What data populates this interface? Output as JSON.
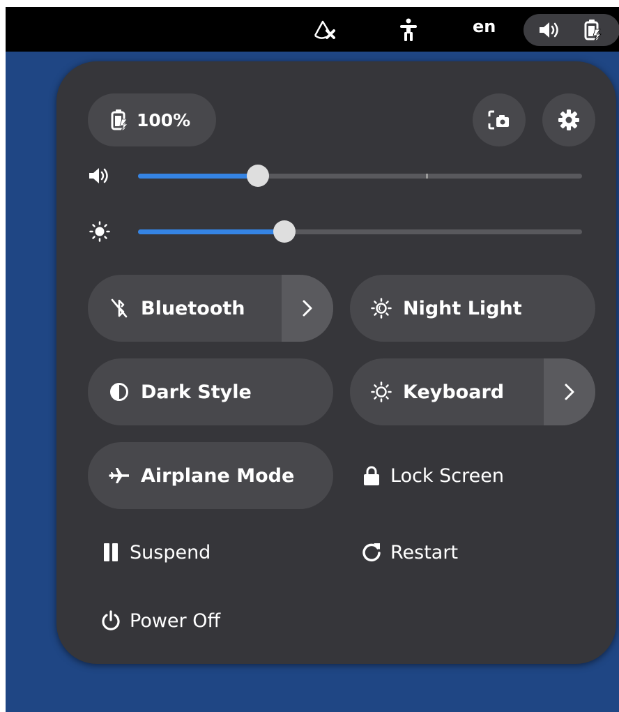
{
  "topbar": {
    "icons": [
      "no-network-icon",
      "accessibility-icon",
      "volume-icon",
      "battery-charging-icon"
    ],
    "language": "en"
  },
  "quick_settings": {
    "battery": {
      "icon": "battery-charging-icon",
      "label": "100%"
    },
    "buttons": [
      "screenshot-icon",
      "settings-icon"
    ],
    "volume": {
      "icon": "volume-icon",
      "level": 0.27
    },
    "brightness": {
      "icon": "brightness-icon",
      "level": 0.33
    },
    "toggles": [
      {
        "label": "Bluetooth",
        "icon": "bluetooth-disabled-icon",
        "has_menu": true
      },
      {
        "label": "Night Light",
        "icon": "night-light-icon",
        "has_menu": false
      },
      {
        "label": "Dark Style",
        "icon": "dark-style-icon",
        "has_menu": false
      },
      {
        "label": "Keyboard",
        "icon": "keyboard-brightness-icon",
        "has_menu": true
      },
      {
        "label": "Airplane Mode",
        "icon": "airplane-icon",
        "has_menu": false
      }
    ],
    "actions": {
      "lock": "Lock Screen",
      "suspend": "Suspend",
      "restart": "Restart",
      "power_off": "Power Off"
    }
  },
  "colors": {
    "desktop": "#1f4684",
    "panel": "#36363a",
    "button": "#48484c",
    "accent": "#3584e4"
  }
}
